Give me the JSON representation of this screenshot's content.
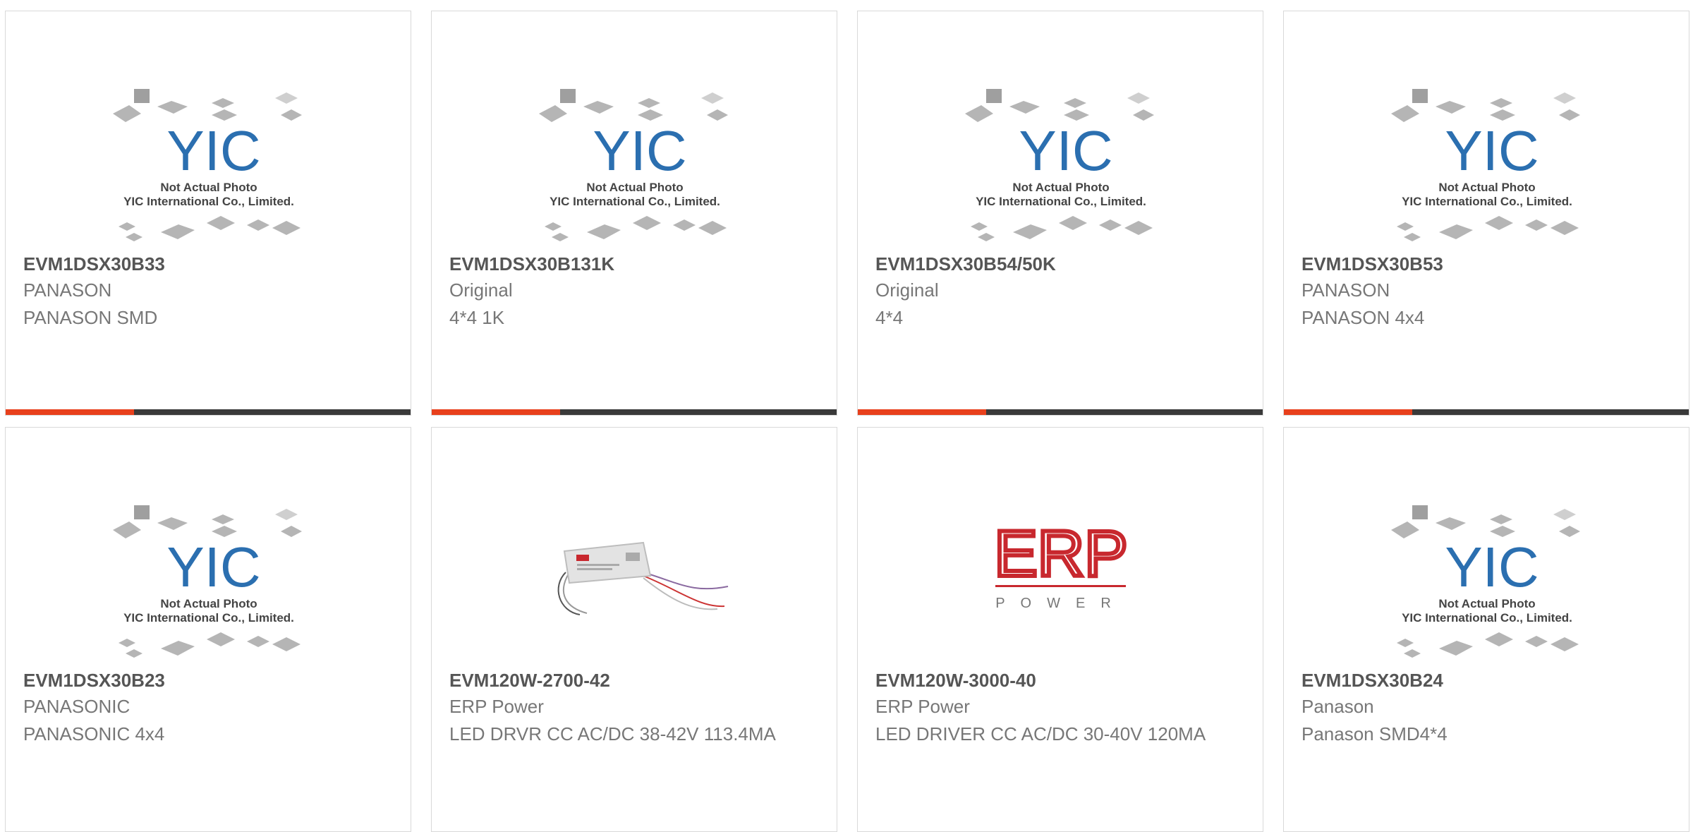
{
  "placeholder": {
    "line1": "Not Actual Photo",
    "line2": "YIC International Co., Limited.",
    "logo_text": "YIC"
  },
  "colors": {
    "accent": "#e8401c",
    "bar": "#3a3a3a",
    "yic_blue": "#2b6fb0",
    "erp_red": "#c8282e"
  },
  "products": [
    {
      "part": "EVM1DSX30B33",
      "manufacturer": "PANASON",
      "desc": "PANASON SMD",
      "image": "yic-placeholder"
    },
    {
      "part": "EVM1DSX30B131K",
      "manufacturer": "Original",
      "desc": "4*4 1K",
      "image": "yic-placeholder"
    },
    {
      "part": "EVM1DSX30B54/50K",
      "manufacturer": "Original",
      "desc": "4*4",
      "image": "yic-placeholder"
    },
    {
      "part": "EVM1DSX30B53",
      "manufacturer": "PANASON",
      "desc": "PANASON 4x4",
      "image": "yic-placeholder"
    },
    {
      "part": "EVM1DSX30B23",
      "manufacturer": "PANASONIC",
      "desc": "PANASONIC 4x4",
      "image": "yic-placeholder"
    },
    {
      "part": "EVM120W-2700-42",
      "manufacturer": "ERP Power",
      "desc": "LED DRVR CC AC/DC 38-42V 113.4MA",
      "image": "led-driver-photo"
    },
    {
      "part": "EVM120W-3000-40",
      "manufacturer": "ERP Power",
      "desc": "LED DRIVER CC AC/DC 30-40V 120MA",
      "image": "erp-power-logo"
    },
    {
      "part": "EVM1DSX30B24",
      "manufacturer": "Panason",
      "desc": "Panason SMD4*4",
      "image": "yic-placeholder"
    }
  ]
}
